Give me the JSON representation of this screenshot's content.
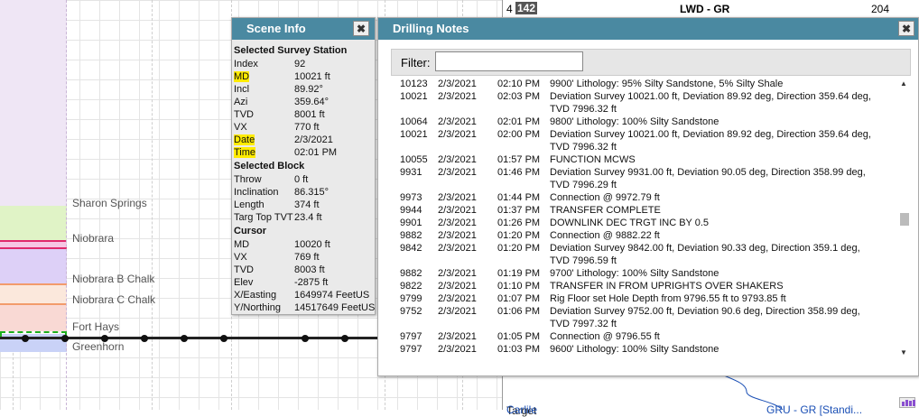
{
  "formations": [
    {
      "name": "Sharon Springs"
    },
    {
      "name": "Niobrara"
    },
    {
      "name": "Niobrara B Chalk"
    },
    {
      "name": "Niobrara C Chalk"
    },
    {
      "name": "Fort Hays"
    },
    {
      "name": "Greenhorn"
    }
  ],
  "log_panel": {
    "track_no": "4",
    "track_value": "142",
    "log_name": "LWD - GR",
    "max_value": "204",
    "bottom_left": "Carlile",
    "bottom_right": "GRU - GR [Standi..."
  },
  "partial_label": "Target",
  "scene_info": {
    "title": "Scene Info",
    "close": "✖",
    "station_header": "Selected Survey Station",
    "station": [
      {
        "label": "Index",
        "value": "92"
      },
      {
        "label": "MD",
        "value": "10021 ft"
      },
      {
        "label": "Incl",
        "value": "89.92°"
      },
      {
        "label": "Azi",
        "value": "359.64°"
      },
      {
        "label": "TVD",
        "value": "8001 ft"
      },
      {
        "label": "VX",
        "value": "770 ft"
      },
      {
        "label": "Date",
        "value": "2/3/2021"
      },
      {
        "label": "Time",
        "value": "02:01 PM"
      }
    ],
    "block_header": "Selected Block",
    "block": [
      {
        "label": "Throw",
        "value": "0 ft"
      },
      {
        "label": "Inclination",
        "value": "86.315°"
      },
      {
        "label": "Length",
        "value": "374 ft"
      },
      {
        "label": "Targ Top TVT",
        "value": "23.4 ft"
      }
    ],
    "cursor_header": "Cursor",
    "cursor": [
      {
        "label": "MD",
        "value": "10020 ft"
      },
      {
        "label": "VX",
        "value": "769 ft"
      },
      {
        "label": "TVD",
        "value": "8003 ft"
      },
      {
        "label": "Elev",
        "value": "-2875 ft"
      },
      {
        "label": "X/Easting",
        "value": "1649974 FeetUS"
      },
      {
        "label": "Y/Northing",
        "value": "14517649 FeetUS"
      }
    ]
  },
  "drilling_notes": {
    "title": "Drilling Notes",
    "close": "✖",
    "filter_label": "Filter:",
    "filter_value": "",
    "notes": [
      {
        "md": "10123",
        "date": "2/3/2021",
        "time": "02:10 PM",
        "text": "9900' Lithology: 95% Silty Sandstone, 5% Silty Shale"
      },
      {
        "md": "10021",
        "date": "2/3/2021",
        "time": "02:03 PM",
        "text": "Deviation Survey 10021.00 ft, Deviation 89.92 deg, Direction 359.64 deg, TVD 7996.32 ft"
      },
      {
        "md": "10064",
        "date": "2/3/2021",
        "time": "02:01 PM",
        "text": "9800' Lithology: 100% Silty Sandstone"
      },
      {
        "md": "10021",
        "date": "2/3/2021",
        "time": "02:00 PM",
        "text": "Deviation Survey 10021.00 ft, Deviation 89.92 deg, Direction 359.64 deg, TVD 7996.32 ft"
      },
      {
        "md": "10055",
        "date": "2/3/2021",
        "time": "01:57 PM",
        "text": "FUNCTION MCWS"
      },
      {
        "md": "9931",
        "date": "2/3/2021",
        "time": "01:46 PM",
        "text": "Deviation Survey 9931.00 ft, Deviation 90.05 deg, Direction 358.99 deg, TVD 7996.29 ft"
      },
      {
        "md": "9973",
        "date": "2/3/2021",
        "time": "01:44 PM",
        "text": "Connection @ 9972.79 ft"
      },
      {
        "md": "9944",
        "date": "2/3/2021",
        "time": "01:37 PM",
        "text": "TRANSFER COMPLETE"
      },
      {
        "md": "9901",
        "date": "2/3/2021",
        "time": "01:26 PM",
        "text": "DOWNLINK DEC TRGT INC BY 0.5"
      },
      {
        "md": "9882",
        "date": "2/3/2021",
        "time": "01:20 PM",
        "text": "Connection @ 9882.22 ft"
      },
      {
        "md": "9842",
        "date": "2/3/2021",
        "time": "01:20 PM",
        "text": "Deviation Survey 9842.00 ft, Deviation 90.33 deg, Direction 359.1 deg, TVD 7996.59 ft"
      },
      {
        "md": "9882",
        "date": "2/3/2021",
        "time": "01:19 PM",
        "text": "9700' Lithology: 100% Silty Sandstone"
      },
      {
        "md": "9822",
        "date": "2/3/2021",
        "time": "01:10 PM",
        "text": "TRANSFER IN FROM UPRIGHTS OVER SHAKERS"
      },
      {
        "md": "9799",
        "date": "2/3/2021",
        "time": "01:07 PM",
        "text": "Rig Floor set Hole Depth from 9796.55 ft to 9793.85 ft"
      },
      {
        "md": "9752",
        "date": "2/3/2021",
        "time": "01:06 PM",
        "text": "Deviation Survey 9752.00 ft, Deviation 90.6 deg, Direction 358.99 deg, TVD 7997.32 ft"
      },
      {
        "md": "9797",
        "date": "2/3/2021",
        "time": "01:05 PM",
        "text": "Connection @ 9796.55 ft"
      },
      {
        "md": "9797",
        "date": "2/3/2021",
        "time": "01:03 PM",
        "text": "9600' Lithology: 100% Silty Sandstone"
      }
    ]
  },
  "colors": {
    "title_bar": "#4a89a1",
    "highlight": "#ffeb00",
    "well_path": "#222222"
  }
}
